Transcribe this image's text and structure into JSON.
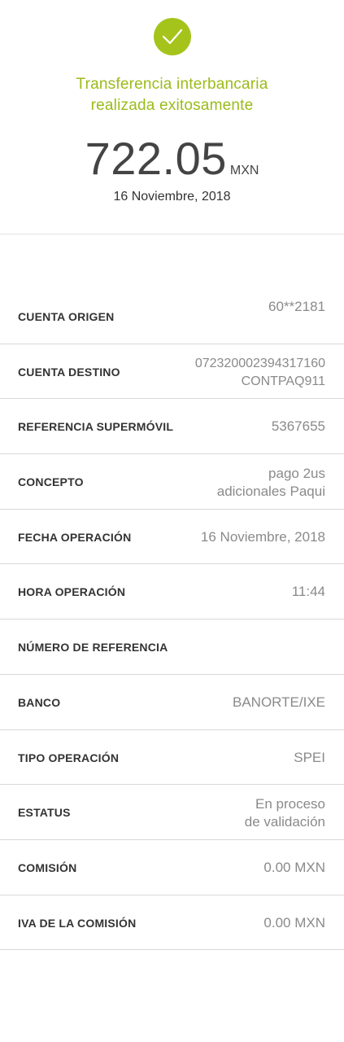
{
  "header": {
    "status_icon": "check-icon",
    "accent_color": "#a4c41c",
    "title_line1": "Transferencia interbancaria",
    "title_line2": "realizada exitosamente",
    "amount": "722.05",
    "currency": "MXN",
    "date": "16 Noviembre, 2018"
  },
  "details": {
    "cuenta_origen": {
      "label": "CUENTA ORIGEN",
      "value": "60**2181"
    },
    "cuenta_destino": {
      "label": "CUENTA DESTINO",
      "value_line1": "072320002394317160",
      "value_line2": "CONTPAQ911"
    },
    "referencia_supermovil": {
      "label": "REFERENCIA SUPERMÓVIL",
      "value": "5367655"
    },
    "concepto": {
      "label": "CONCEPTO",
      "value_line1": "pago 2us",
      "value_line2": "adicionales Paqui"
    },
    "fecha_operacion": {
      "label": "FECHA OPERACIÓN",
      "value": "16 Noviembre, 2018"
    },
    "hora_operacion": {
      "label": "HORA OPERACIÓN",
      "value": "11:44"
    },
    "numero_referencia": {
      "label": "NÚMERO DE REFERENCIA",
      "value": ""
    },
    "banco": {
      "label": "BANCO",
      "value": "BANORTE/IXE"
    },
    "tipo_operacion": {
      "label": "TIPO OPERACIÓN",
      "value": "SPEI"
    },
    "estatus": {
      "label": "ESTATUS",
      "value_line1": "En proceso",
      "value_line2": "de validación"
    },
    "comision": {
      "label": "COMISIÓN",
      "value": "0.00 MXN"
    },
    "iva_comision": {
      "label": "IVA DE LA COMISIÓN",
      "value": "0.00 MXN"
    }
  }
}
